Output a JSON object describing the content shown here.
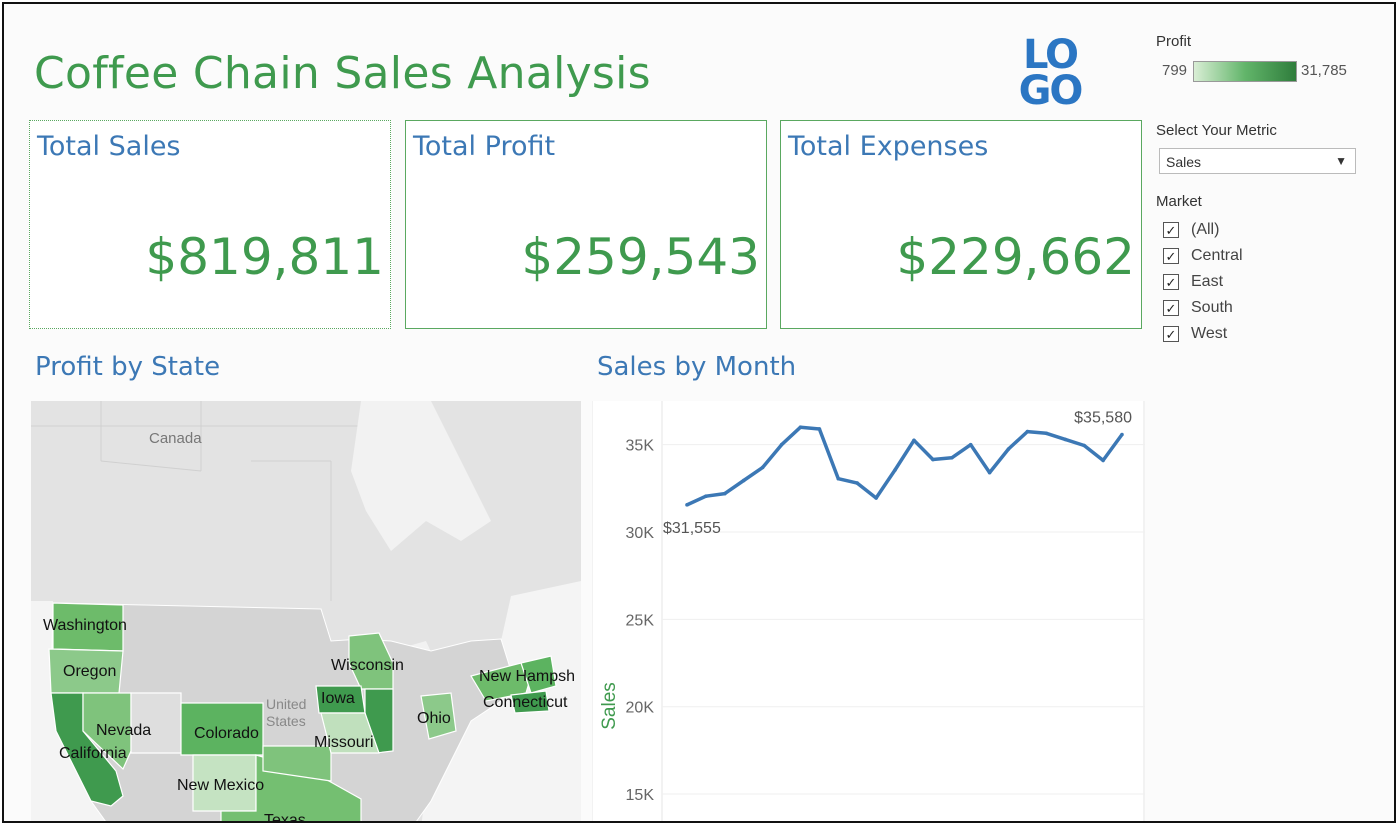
{
  "dashboard": {
    "title": "Coffee Chain Sales Analysis",
    "logo_lines": [
      "LO",
      "GO"
    ],
    "brand_color": "#3f9a4e",
    "accent_color": "#3c78b5"
  },
  "legend": {
    "title": "Profit",
    "min_label": "799",
    "max_label": "31,785"
  },
  "controls": {
    "metric_label": "Select Your Metric",
    "metric_value": "Sales",
    "market_label": "Market",
    "market_options": [
      {
        "label": "(All)",
        "checked": true
      },
      {
        "label": "Central",
        "checked": true
      },
      {
        "label": "East",
        "checked": true
      },
      {
        "label": "South",
        "checked": true
      },
      {
        "label": "West",
        "checked": true
      }
    ],
    "checkmark": "✓"
  },
  "kpis": [
    {
      "title": "Total Sales",
      "value": "$819,811"
    },
    {
      "title": "Total Profit",
      "value": "$259,543"
    },
    {
      "title": "Total Expenses",
      "value": "$229,662"
    }
  ],
  "map": {
    "title": "Profit by State",
    "labels": {
      "canada": "Canada",
      "us_line1": "United",
      "us_line2": "States",
      "washington": "Washington",
      "oregon": "Oregon",
      "nevada": "Nevada",
      "california": "California",
      "colorado": "Colorado",
      "new_mexico": "New Mexico",
      "texas": "Texas",
      "iowa": "Iowa",
      "wisconsin": "Wisconsin",
      "missouri": "Missouri",
      "ohio": "Ohio",
      "new_hampshire": "New Hampsh",
      "connecticut": "Connecticut"
    }
  },
  "chart_data": {
    "type": "line",
    "title": "Sales by Month",
    "ylabel": "Sales",
    "xlabel": "",
    "ylim": [
      13000,
      37500
    ],
    "yticks": [
      15000,
      20000,
      25000,
      30000,
      35000
    ],
    "ytick_labels": [
      "15K",
      "20K",
      "25K",
      "30K",
      "35K"
    ],
    "grid": true,
    "color": "#3c78b5",
    "series": [
      {
        "values": [
          31555,
          32050,
          32200,
          32950,
          33700,
          35000,
          36000,
          35900,
          33050,
          32800,
          31950,
          33550,
          35250,
          34150,
          34250,
          35000,
          33400,
          34750,
          35750,
          35650,
          35300,
          34950,
          34100,
          35580
        ]
      }
    ],
    "annotations": [
      {
        "text": "$31,555",
        "index": 0
      },
      {
        "text": "$35,580",
        "index": 23
      }
    ]
  }
}
